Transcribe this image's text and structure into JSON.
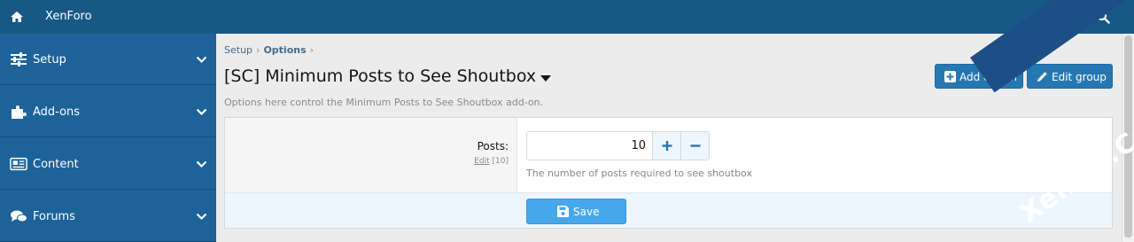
{
  "topbar": {
    "brand": "XenForo",
    "home_icon": "home-icon",
    "search_icon": "search-icon"
  },
  "sidebar": {
    "items": [
      {
        "label": "Setup",
        "icon": "sliders-icon"
      },
      {
        "label": "Add-ons",
        "icon": "puzzle-icon"
      },
      {
        "label": "Content",
        "icon": "newspaper-icon"
      },
      {
        "label": "Forums",
        "icon": "comments-icon"
      }
    ]
  },
  "breadcrumb": {
    "items": [
      "Setup",
      "Options"
    ]
  },
  "page": {
    "title": "[SC] Minimum Posts to See Shoutbox",
    "description": "Options here control the Minimum Posts to See Shoutbox add-on."
  },
  "actions": {
    "add_option": "Add option",
    "edit_group": "Edit group"
  },
  "option": {
    "label": "Posts:",
    "edit_link": "Edit",
    "display_order": "[10]",
    "value": "10",
    "explain": "The number of posts required to see shoutbox"
  },
  "footer": {
    "save": "Save"
  },
  "watermark": {
    "text": "XenBD.Com"
  },
  "colors": {
    "topbar": "#185886",
    "sidebar": "#1d6299",
    "button": "#2577b1",
    "save": "#47a7eb",
    "footer": "#edf6fd"
  }
}
